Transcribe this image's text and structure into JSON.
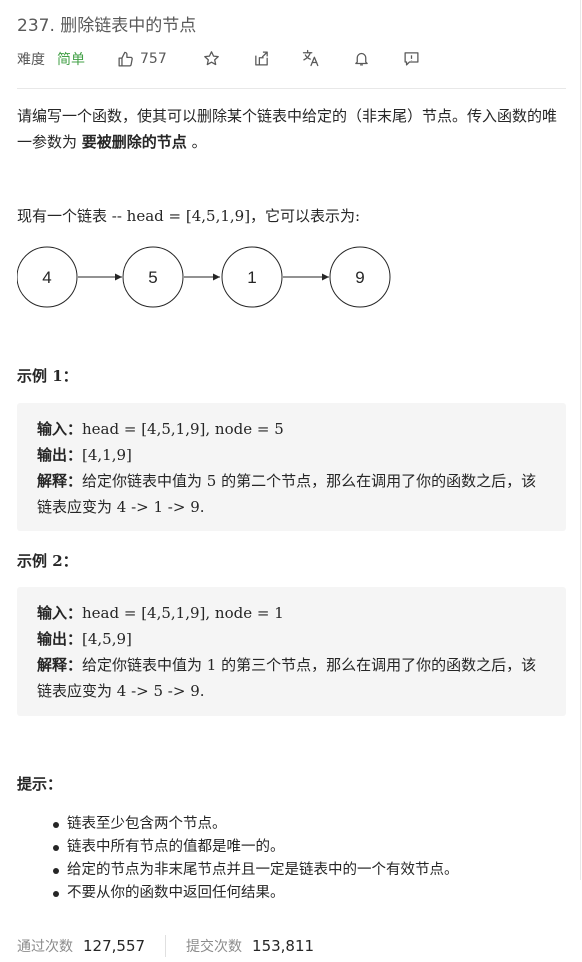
{
  "problem": {
    "title": "237. 删除链表中的节点",
    "difficulty_label": "难度",
    "difficulty": "简单",
    "likes": "757",
    "icons": [
      "thumbs-up-icon",
      "star-icon",
      "share-icon",
      "translate-icon",
      "bell-icon",
      "feedback-icon"
    ]
  },
  "description": {
    "text": "请编写一个函数，使其可以删除某个链表中给定的（非末尾）节点。传入函数的唯一参数为 ",
    "bold": "要被删除的节点",
    "tail": " 。",
    "list_intro": "现有一个链表 -- head = [4,5,1,9]，它可以表示为:",
    "nodes": [
      "4",
      "5",
      "1",
      "9"
    ]
  },
  "examples": [
    {
      "title": "示例 1：",
      "input_label": "输入：",
      "input": "head = [4,5,1,9], node = 5",
      "output_label": "输出：",
      "output": "[4,1,9]",
      "explain_label": "解释：",
      "explain": "给定你链表中值为 5 的第二个节点，那么在调用了你的函数之后，该链表应变为 4 -> 1 -> 9."
    },
    {
      "title": "示例 2：",
      "input_label": "输入：",
      "input": "head = [4,5,1,9], node = 1",
      "output_label": "输出：",
      "output": "[4,5,9]",
      "explain_label": "解释：",
      "explain": "给定你链表中值为 1 的第三个节点，那么在调用了你的函数之后，该链表应变为 4 -> 5 -> 9."
    }
  ],
  "hints": {
    "title": "提示：",
    "items": [
      "链表至少包含两个节点。",
      "链表中所有节点的值都是唯一的。",
      "给定的节点为非末尾节点并且一定是链表中的一个有效节点。",
      "不要从你的函数中返回任何结果。"
    ]
  },
  "stats": {
    "accepted_label": "通过次数",
    "accepted": "127,557",
    "submitted_label": "提交次数",
    "submitted": "153,811"
  },
  "colors": {
    "difficulty_easy": "#43a047",
    "text": "#262626",
    "muted": "#8c8c8c",
    "example_bg": "#f5f5f5"
  }
}
